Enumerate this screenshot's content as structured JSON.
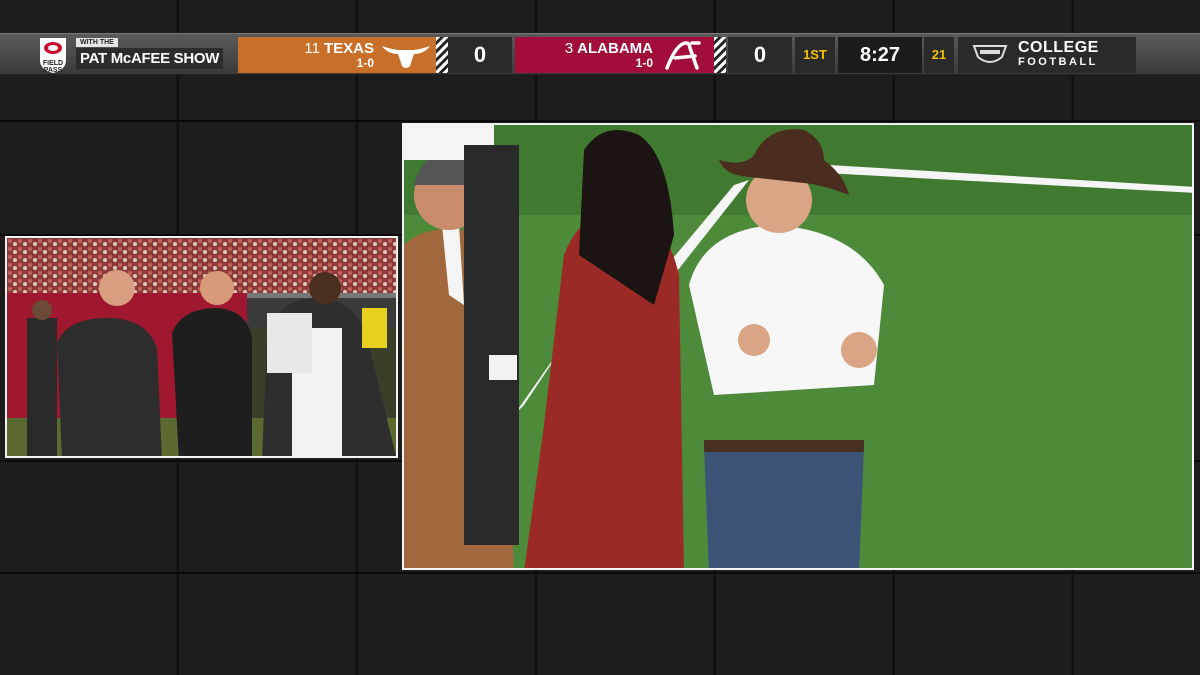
{
  "scorebug": {
    "show": {
      "badge_label": "FIELD PASS",
      "with_the": "WITH THE",
      "name": "PAT McAFEE SHOW"
    },
    "away": {
      "rank": "11",
      "name": "TEXAS",
      "record": "1-0",
      "score": "0",
      "color": "#c8702a",
      "logo": "longhorn-logo-icon"
    },
    "home": {
      "rank": "3",
      "name": "ALABAMA",
      "record": "1-0",
      "score": "0",
      "color": "#a30d3a",
      "logo": "script-a-logo-icon"
    },
    "quarter": "1ST",
    "clock": "8:27",
    "play_clock": "21",
    "network": {
      "logo": "espn-shield-icon",
      "line1": "COLLEGE",
      "line2": "FOOTBALL"
    }
  },
  "feeds": {
    "left": "pip-sideline-interview-feed",
    "main": "main-field-feed"
  }
}
